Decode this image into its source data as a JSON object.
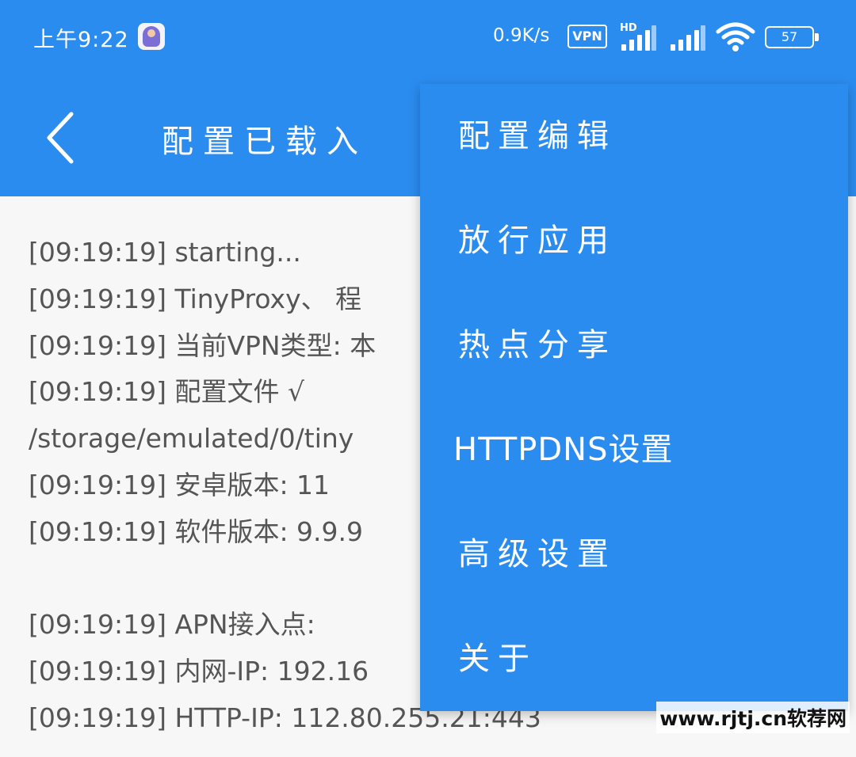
{
  "status_bar": {
    "time": "上午9:22",
    "net_speed": "0.9K/s",
    "vpn_label": "VPN",
    "hd_label": "HD",
    "battery": "57",
    "icons": [
      "app-notification-icon",
      "vpn-icon",
      "signal-hd-icon",
      "signal-icon",
      "wifi-icon",
      "battery-icon"
    ]
  },
  "toolbar": {
    "back_icon": "chevron-left-icon",
    "title": "配置已载入",
    "background": "#2b8cf0"
  },
  "log": {
    "lines": [
      "[09:19:19] starting...",
      "[09:19:19] TinyProxy、 程",
      "[09:19:19] 当前VPN类型: 本",
      "[09:19:19] 配置文件 √",
      "/storage/emulated/0/tiny",
      "[09:19:19] 安卓版本: 11",
      "[09:19:19] 软件版本: 9.9.9",
      "",
      "[09:19:19] APN接入点:",
      "[09:19:19] 内网-IP: 192.16",
      "[09:19:19] HTTP-IP: 112.80.255.21:443"
    ]
  },
  "menu": {
    "items": [
      {
        "label": "配置编辑"
      },
      {
        "label": "放行应用"
      },
      {
        "label": "热点分享"
      },
      {
        "label": "HTTPDNS设置"
      },
      {
        "label": "高级设置"
      },
      {
        "label": "关于"
      }
    ]
  },
  "watermark": "www.rjtj.cn软荐网"
}
